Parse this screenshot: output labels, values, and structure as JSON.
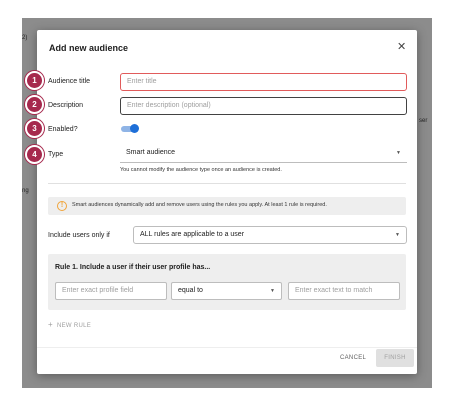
{
  "background": {
    "fragment_top": "2)",
    "fragment_mid": "ng",
    "fragment_right": "ser"
  },
  "modal": {
    "title": "Add new audience",
    "close_icon": "close-icon"
  },
  "steps": [
    "1",
    "2",
    "3",
    "4"
  ],
  "form": {
    "title_label": "Audience title",
    "title_placeholder": "Enter title",
    "description_label": "Description",
    "description_placeholder": "Enter description (optional)",
    "enabled_label": "Enabled?",
    "enabled": true,
    "type_label": "Type",
    "type_value": "Smart audience",
    "type_hint": "You cannot modify the audience type once an audience is created."
  },
  "alert": {
    "icon": "info-icon",
    "text": "Smart audiences dynamically add and remove users using the rules you apply. At least 1 rule is required."
  },
  "include": {
    "label": "Include users only if",
    "value": "ALL rules are applicable to a user"
  },
  "rule": {
    "title": "Rule 1. Include a user if their user profile has...",
    "field_placeholder": "Enter exact profile field",
    "operator": "equal to",
    "value_placeholder": "Enter exact text to match"
  },
  "new_rule_label": "NEW RULE",
  "footer": {
    "cancel": "CANCEL",
    "finish": "FINISH"
  },
  "colors": {
    "step_badge": "#a6294d",
    "toggle_on": "#1e6fd8",
    "error_border": "#e15b5b",
    "warning": "#f0a43a"
  }
}
